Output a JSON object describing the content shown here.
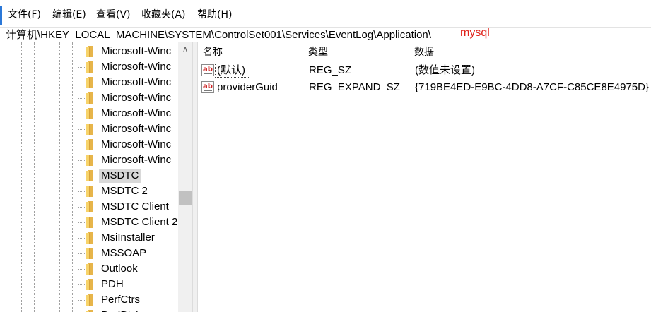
{
  "menu": [
    "文件(F)",
    "编辑(E)",
    "查看(V)",
    "收藏夹(A)",
    "帮助(H)"
  ],
  "address": {
    "path": "计算机\\HKEY_LOCAL_MACHINE\\SYSTEM\\ControlSet001\\Services\\EventLog\\Application\\",
    "annotation": "mysql",
    "annotation_color": "#e0221a"
  },
  "tree": {
    "items": [
      {
        "label": "Microsoft-Winc",
        "selected": false
      },
      {
        "label": "Microsoft-Winc",
        "selected": false
      },
      {
        "label": "Microsoft-Winc",
        "selected": false
      },
      {
        "label": "Microsoft-Winc",
        "selected": false
      },
      {
        "label": "Microsoft-Winc",
        "selected": false
      },
      {
        "label": "Microsoft-Winc",
        "selected": false
      },
      {
        "label": "Microsoft-Winc",
        "selected": false
      },
      {
        "label": "Microsoft-Winc",
        "selected": false
      },
      {
        "label": "MSDTC",
        "selected": true
      },
      {
        "label": "MSDTC 2",
        "selected": false
      },
      {
        "label": "MSDTC Client",
        "selected": false
      },
      {
        "label": "MSDTC Client 2",
        "selected": false
      },
      {
        "label": "MsiInstaller",
        "selected": false
      },
      {
        "label": "MSSOAP",
        "selected": false
      },
      {
        "label": "Outlook",
        "selected": false
      },
      {
        "label": "PDH",
        "selected": false
      },
      {
        "label": "PerfCtrs",
        "selected": false
      },
      {
        "label": "PerfDisk",
        "selected": false
      }
    ],
    "scroll_up_glyph": "∧",
    "folder_color": "#f7d36a",
    "icon": "folder-icon"
  },
  "list": {
    "columns": [
      "名称",
      "类型",
      "数据"
    ],
    "rows": [
      {
        "name": "(默认)",
        "type": "REG_SZ",
        "data": "(数值未设置)",
        "icon": "string-value-icon"
      },
      {
        "name": "providerGuid",
        "type": "REG_EXPAND_SZ",
        "data": "{719BE4ED-E9BC-4DD8-A7CF-C85CE8E4975D}",
        "icon": "string-value-icon"
      }
    ],
    "icon_text": "ab"
  }
}
